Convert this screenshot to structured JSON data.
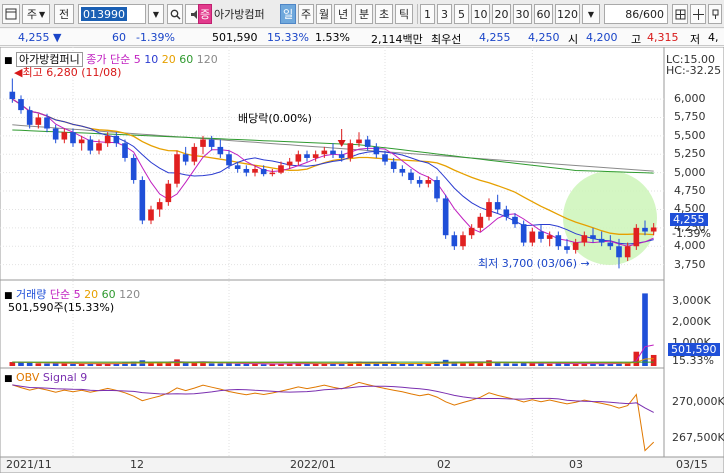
{
  "toolbar": {
    "market_label": "주",
    "prev_label": "전",
    "code": "013990",
    "badge": "증",
    "stock_name": "아가방컴퍼",
    "periods": [
      "일",
      "주",
      "월",
      "년",
      "분",
      "초",
      "틱"
    ],
    "active_period": "일",
    "intervals": [
      "1",
      "3",
      "5",
      "10",
      "20",
      "30",
      "60",
      "120"
    ],
    "count": "86/600"
  },
  "quote": {
    "price": "4,255",
    "change": "60",
    "change_pct": "-1.39%",
    "volume": "501,590",
    "vol_pct": "15.33%",
    "turnover_pct": "1.53%",
    "amount": "2,114백만",
    "best_label": "최우선",
    "ask": "4,255",
    "bid": "4,250",
    "open_label": "시",
    "open": "4,200",
    "high_label": "고",
    "high": "4,315",
    "low_label": "저",
    "low": "4,"
  },
  "price_panel": {
    "name_label": "아가방컴퍼니",
    "ma_label": "종가 단순",
    "ma_periods": [
      "5",
      "10",
      "20",
      "60",
      "120"
    ],
    "lc_label": "LC:15.00",
    "hc_label": "HC:-32.25",
    "max_note": "최고 6,280 (11/08)",
    "min_note": "최저 3,700 (03/06)",
    "dividend_note": "배당락(0.00%)",
    "current_price": "4,255",
    "current_pct": "-1.39%",
    "y_ticks": [
      "6,000",
      "5,750",
      "5,500",
      "5,250",
      "5,000",
      "4,750",
      "4,500",
      "4,250",
      "4,000",
      "3,750"
    ]
  },
  "volume_panel": {
    "title": "거래량",
    "ma_label": "단순",
    "ma_periods": [
      "5",
      "20",
      "60",
      "120"
    ],
    "value_label": "501,590주(15.33%)",
    "current_value": "501,590",
    "current_pct": "15.33%",
    "y_ticks": [
      "3,000K",
      "2,000K",
      "1,000K"
    ]
  },
  "obv_panel": {
    "title": "OBV",
    "signal_label": "Signal 9",
    "y_ticks": [
      "270,000K",
      "267,500K"
    ]
  },
  "dates": [
    "2021/11",
    "12",
    "2022/01",
    "02",
    "03",
    "03/15"
  ],
  "colors": {
    "up": "#e02020",
    "down": "#1f4fd8",
    "ma5": "#c020c0",
    "ma10": "#2b3bd0",
    "ma20": "#e6a000",
    "ma60": "#2f9a2f",
    "ma120": "#8a8a8a",
    "highlight": "#ccf5b8"
  },
  "chart_data": {
    "type": "candlestick",
    "ohlc": [
      [
        6100,
        6280,
        5950,
        6000
      ],
      [
        6000,
        6050,
        5800,
        5850
      ],
      [
        5850,
        5900,
        5600,
        5650
      ],
      [
        5650,
        5800,
        5600,
        5750
      ],
      [
        5750,
        5800,
        5550,
        5600
      ],
      [
        5600,
        5650,
        5400,
        5450
      ],
      [
        5450,
        5600,
        5400,
        5550
      ],
      [
        5550,
        5600,
        5350,
        5400
      ],
      [
        5400,
        5500,
        5300,
        5450
      ],
      [
        5450,
        5500,
        5250,
        5300
      ],
      [
        5300,
        5450,
        5250,
        5400
      ],
      [
        5400,
        5550,
        5350,
        5500
      ],
      [
        5500,
        5550,
        5350,
        5400
      ],
      [
        5400,
        5450,
        5150,
        5200
      ],
      [
        5200,
        5250,
        4850,
        4900
      ],
      [
        4900,
        4950,
        4300,
        4350
      ],
      [
        4350,
        4550,
        4300,
        4500
      ],
      [
        4500,
        4650,
        4400,
        4600
      ],
      [
        4600,
        4900,
        4550,
        4850
      ],
      [
        4850,
        5300,
        4800,
        5250
      ],
      [
        5250,
        5350,
        5100,
        5150
      ],
      [
        5150,
        5400,
        5100,
        5350
      ],
      [
        5350,
        5500,
        5250,
        5450
      ],
      [
        5450,
        5500,
        5300,
        5350
      ],
      [
        5350,
        5450,
        5200,
        5250
      ],
      [
        5250,
        5300,
        5050,
        5100
      ],
      [
        5100,
        5150,
        5000,
        5050
      ],
      [
        5050,
        5100,
        4950,
        5000
      ],
      [
        5000,
        5100,
        4950,
        5050
      ],
      [
        5050,
        5100,
        4950,
        4980
      ],
      [
        4980,
        5050,
        4950,
        5000
      ],
      [
        5000,
        5150,
        4980,
        5100
      ],
      [
        5100,
        5200,
        5050,
        5150
      ],
      [
        5150,
        5300,
        5100,
        5250
      ],
      [
        5250,
        5300,
        5150,
        5200
      ],
      [
        5200,
        5300,
        5150,
        5250
      ],
      [
        5250,
        5350,
        5200,
        5300
      ],
      [
        5300,
        5400,
        5200,
        5250
      ],
      [
        5250,
        5300,
        5150,
        5200
      ],
      [
        5200,
        5450,
        5150,
        5400
      ],
      [
        5400,
        5550,
        5350,
        5450
      ],
      [
        5450,
        5500,
        5300,
        5350
      ],
      [
        5350,
        5400,
        5200,
        5250
      ],
      [
        5250,
        5300,
        5100,
        5150
      ],
      [
        5150,
        5200,
        5000,
        5050
      ],
      [
        5050,
        5100,
        4950,
        5000
      ],
      [
        5000,
        5050,
        4850,
        4900
      ],
      [
        4900,
        4950,
        4800,
        4850
      ],
      [
        4850,
        4950,
        4800,
        4900
      ],
      [
        4900,
        4950,
        4600,
        4650
      ],
      [
        4650,
        4700,
        4100,
        4150
      ],
      [
        4150,
        4200,
        3950,
        4000
      ],
      [
        4000,
        4200,
        3950,
        4150
      ],
      [
        4150,
        4300,
        4100,
        4250
      ],
      [
        4250,
        4450,
        4200,
        4400
      ],
      [
        4400,
        4650,
        4350,
        4600
      ],
      [
        4600,
        4700,
        4450,
        4500
      ],
      [
        4500,
        4550,
        4350,
        4400
      ],
      [
        4400,
        4450,
        4250,
        4300
      ],
      [
        4300,
        4350,
        4000,
        4050
      ],
      [
        4050,
        4250,
        4000,
        4200
      ],
      [
        4200,
        4300,
        4050,
        4100
      ],
      [
        4100,
        4200,
        4000,
        4150
      ],
      [
        4150,
        4200,
        3950,
        4000
      ],
      [
        4000,
        4100,
        3900,
        3950
      ],
      [
        3950,
        4100,
        3900,
        4050
      ],
      [
        4050,
        4200,
        4000,
        4150
      ],
      [
        4150,
        4250,
        4050,
        4100
      ],
      [
        4100,
        4200,
        4000,
        4050
      ],
      [
        4050,
        4150,
        3950,
        4000
      ],
      [
        4000,
        4100,
        3700,
        3850
      ],
      [
        3850,
        4050,
        3800,
        4000
      ],
      [
        4000,
        4300,
        3950,
        4250
      ],
      [
        4250,
        4350,
        4150,
        4200
      ],
      [
        4200,
        4315,
        4150,
        4255
      ]
    ],
    "volume_k": [
      180,
      160,
      150,
      120,
      110,
      130,
      120,
      100,
      90,
      110,
      100,
      120,
      110,
      150,
      200,
      260,
      140,
      130,
      180,
      300,
      160,
      150,
      170,
      120,
      110,
      140,
      100,
      90,
      95,
      80,
      85,
      110,
      120,
      130,
      100,
      95,
      110,
      120,
      100,
      180,
      200,
      130,
      120,
      110,
      100,
      95,
      120,
      110,
      90,
      170,
      280,
      190,
      150,
      140,
      170,
      260,
      150,
      120,
      110,
      160,
      130,
      110,
      100,
      120,
      110,
      100,
      120,
      90,
      100,
      110,
      170,
      150,
      650,
      3300,
      502
    ]
  }
}
